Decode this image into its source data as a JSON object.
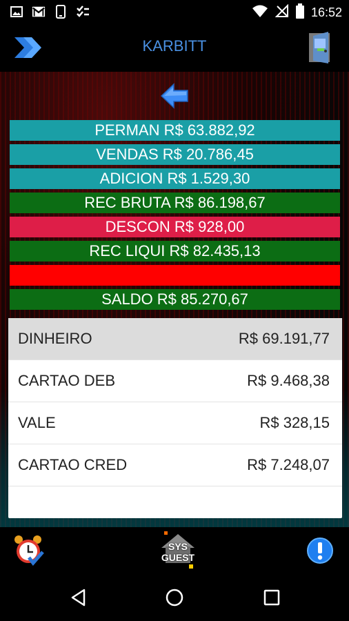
{
  "status_bar": {
    "time": "16:52",
    "left_icons": [
      "image-icon",
      "gmail-icon",
      "phone-icon",
      "checklist-icon"
    ],
    "right_icons": [
      "wifi-icon",
      "no-signal-icon",
      "battery-icon"
    ]
  },
  "app_bar": {
    "title": "KARBITT",
    "menu_icon": "double-chevron-right-icon",
    "exit_icon": "door-exit-icon",
    "accent_color": "#4a90e2"
  },
  "back_icon": "arrow-left-icon",
  "summary_bars": [
    {
      "label": "PERMAN R$ 63.882,92",
      "color": "#1a9fa6"
    },
    {
      "label": "VENDAS R$ 20.786,45",
      "color": "#1a9fa6"
    },
    {
      "label": "ADICION R$ 1.529,30",
      "color": "#1a9fa6"
    },
    {
      "label": "REC BRUTA R$ 86.198,67",
      "color": "#0c6d14"
    },
    {
      "label": "DESCON R$ 928,00",
      "color": "#de1e48"
    },
    {
      "label": "REC LIQUI R$ 82.435,13",
      "color": "#0c6d14"
    },
    {
      "label": "",
      "color": "#ff0000"
    },
    {
      "label": "SALDO R$ 85.270,67",
      "color": "#0c6d14"
    }
  ],
  "payments": [
    {
      "name": "DINHEIRO",
      "value": "R$ 69.191,77",
      "selected": true
    },
    {
      "name": "CARTAO DEB",
      "value": "R$ 9.468,38",
      "selected": false
    },
    {
      "name": "VALE",
      "value": "R$ 328,15",
      "selected": false
    },
    {
      "name": "CARTAO CRED",
      "value": "R$ 7.248,07",
      "selected": false
    }
  ],
  "action_bar": {
    "alarm_icon": "alarm-clock-icon",
    "sys_label_1": "SYS",
    "sys_label_2": "GUEST",
    "alert_icon": "exclamation-icon"
  },
  "nav_bar": {
    "icons": [
      "nav-back-icon",
      "nav-home-icon",
      "nav-recents-icon"
    ]
  }
}
